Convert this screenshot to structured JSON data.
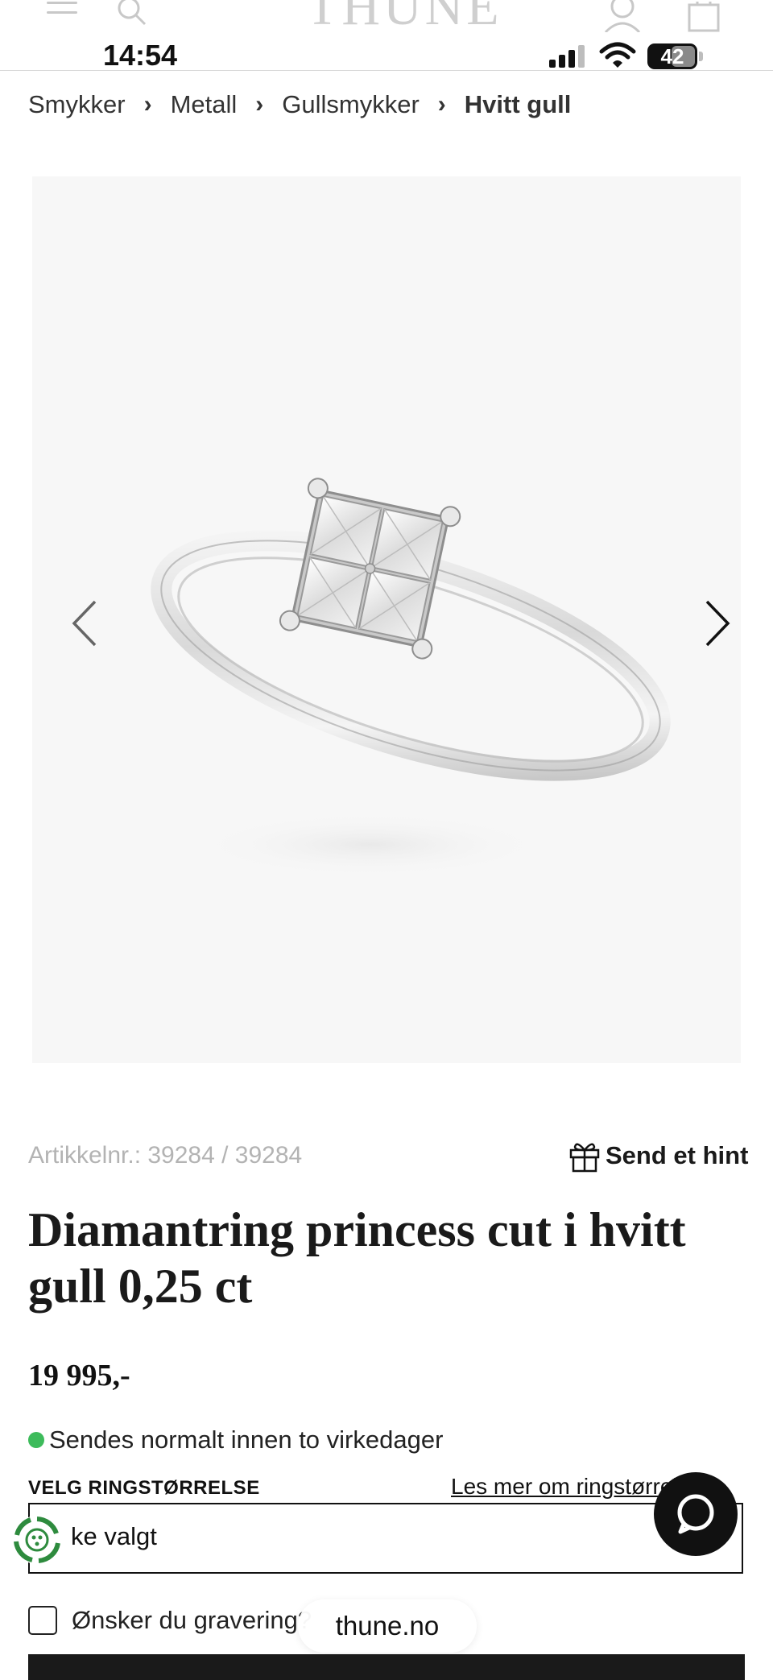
{
  "status_bar": {
    "time": "14:54",
    "battery": "42"
  },
  "header": {
    "logo": "THUNE",
    "icons": [
      "menu-icon",
      "search-icon",
      "user-icon",
      "bag-icon"
    ]
  },
  "breadcrumb": {
    "items": [
      "Smykker",
      "Metall",
      "Gullsmykker"
    ],
    "current": "Hvitt gull",
    "separator": "›"
  },
  "gallery": {
    "image": "white gold ring with four princess cut diamonds",
    "prev_icon": "chevron-left-icon",
    "next_icon": "chevron-right-icon"
  },
  "product": {
    "article_number": "Artikkelnr.: 39284 / 39284",
    "send_hint": "Send et hint",
    "title": "Diamantring princess cut i hvitt gull 0,25 ct",
    "price": "19 995,-",
    "stock_text": "Sendes normalt innen to virkedager",
    "stock_color": "#3dbb5b"
  },
  "size_selector": {
    "label": "VELG RINGSTØRRELSE",
    "link": "Les mer om ringstørrelser",
    "value": "ke valgt"
  },
  "engraving": {
    "label": "Ønsker du gravering?"
  },
  "browser": {
    "url": "thune.no"
  },
  "colors": {
    "accent": "#111111",
    "background": "#ffffff",
    "image_bg": "#f7f7f7"
  }
}
